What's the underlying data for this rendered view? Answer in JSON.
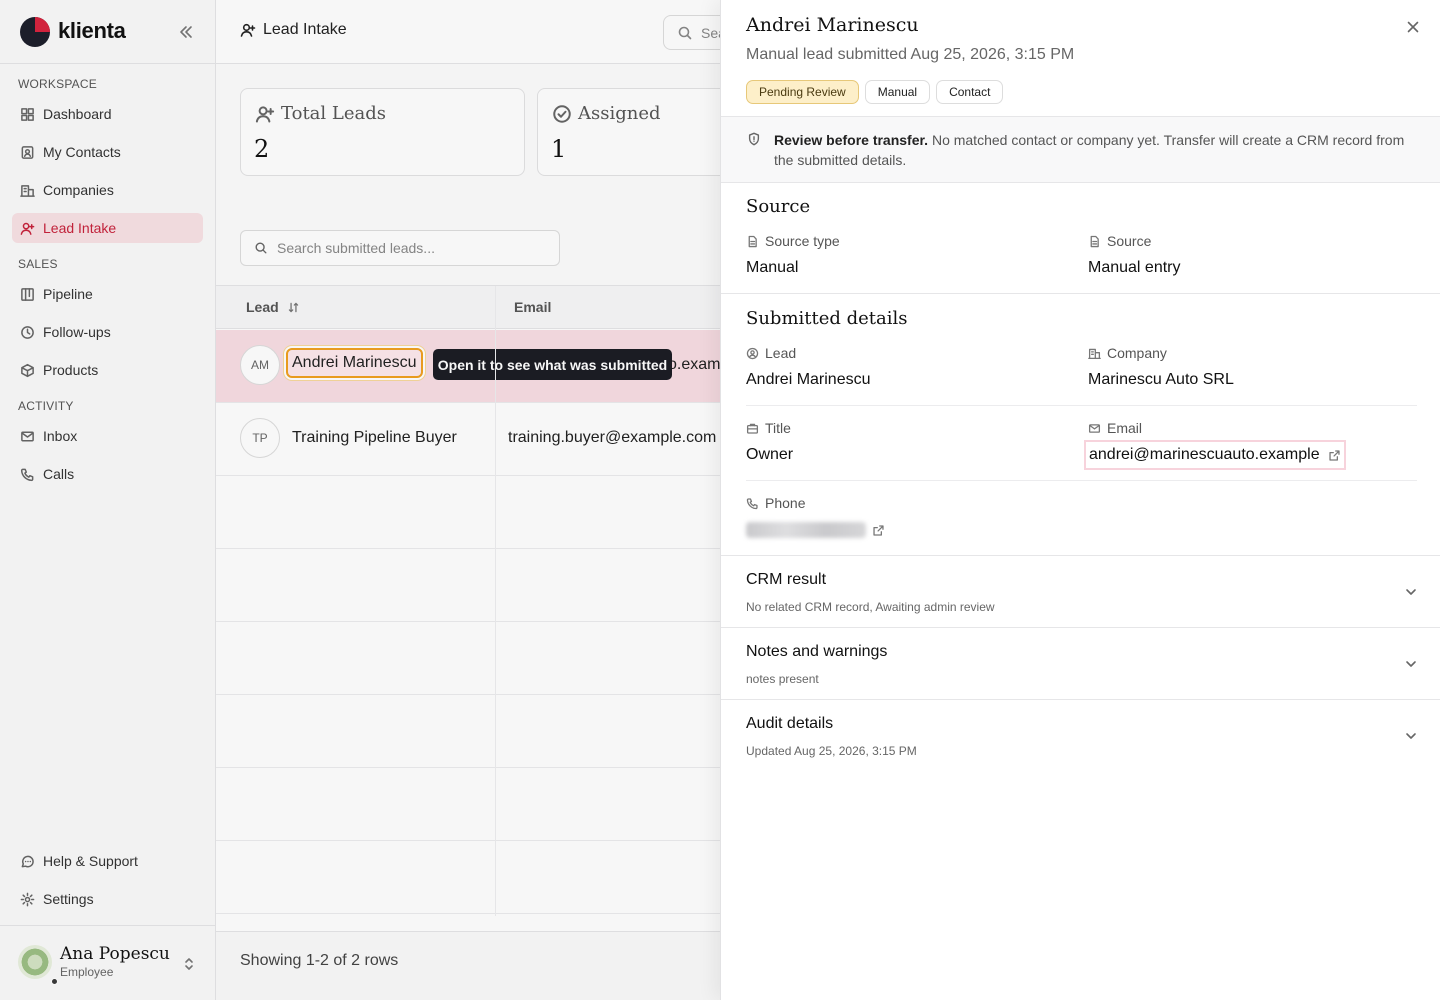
{
  "sidebar": {
    "brand": "klienta",
    "sections": {
      "workspace": "WORKSPACE",
      "sales": "SALES",
      "activity": "ACTIVITY"
    },
    "items": {
      "dashboard": "Dashboard",
      "contacts": "My Contacts",
      "companies": "Companies",
      "lead_intake": "Lead Intake",
      "pipeline": "Pipeline",
      "followups": "Follow-ups",
      "products": "Products",
      "inbox": "Inbox",
      "calls": "Calls",
      "help": "Help & Support",
      "settings": "Settings"
    },
    "active_item": "Lead Intake",
    "user": {
      "name": "Ana Popescu",
      "role": "Employee"
    }
  },
  "header": {
    "title": "Lead Intake",
    "search_placeholder": "Sea"
  },
  "stats": [
    {
      "label": "Total Leads",
      "value": "2"
    },
    {
      "label": "Assigned",
      "value": "1"
    }
  ],
  "leads_search_placeholder": "Search submitted leads...",
  "table": {
    "columns": [
      "Lead",
      "Email"
    ],
    "rows": [
      {
        "initials": "AM",
        "name": "Andrei Marinescu",
        "email": "o.exam"
      },
      {
        "initials": "TP",
        "name": "Training Pipeline Buyer",
        "email": "training.buyer@example.com"
      }
    ]
  },
  "tooltip": "Open it to see what was submitted",
  "footer": "Showing 1-2 of 2 rows",
  "panel": {
    "title": "Andrei Marinescu",
    "subtitle": "Manual lead submitted Aug 25, 2026, 3:15 PM",
    "chips": [
      "Pending Review",
      "Manual",
      "Contact"
    ],
    "banner_bold": "Review before transfer.",
    "banner_text": " No matched contact or company yet. Transfer will create a CRM record from the submitted details.",
    "source": {
      "heading": "Source",
      "source_type_label": "Source type",
      "source_type": "Manual",
      "source_label": "Source",
      "source": "Manual entry"
    },
    "submitted": {
      "heading": "Submitted details",
      "lead_label": "Lead",
      "lead": "Andrei Marinescu",
      "company_label": "Company",
      "company": "Marinescu Auto SRL",
      "title_label": "Title",
      "title": "Owner",
      "email_label": "Email",
      "email": "andrei@marinescuauto.example",
      "phone_label": "Phone"
    },
    "accordions": [
      {
        "title": "CRM result",
        "summary": "No related CRM record, Awaiting admin review"
      },
      {
        "title": "Notes and warnings",
        "summary": "notes present"
      },
      {
        "title": "Audit details",
        "summary": "Updated Aug 25, 2026, 3:15 PM"
      }
    ]
  },
  "colors": {
    "accent": "#c8233c",
    "active_bg": "#f8e1e5",
    "pending_chip": "#fdefc9",
    "focus_ring": "#f0a020",
    "tooltip_bg": "#1b1c24"
  }
}
